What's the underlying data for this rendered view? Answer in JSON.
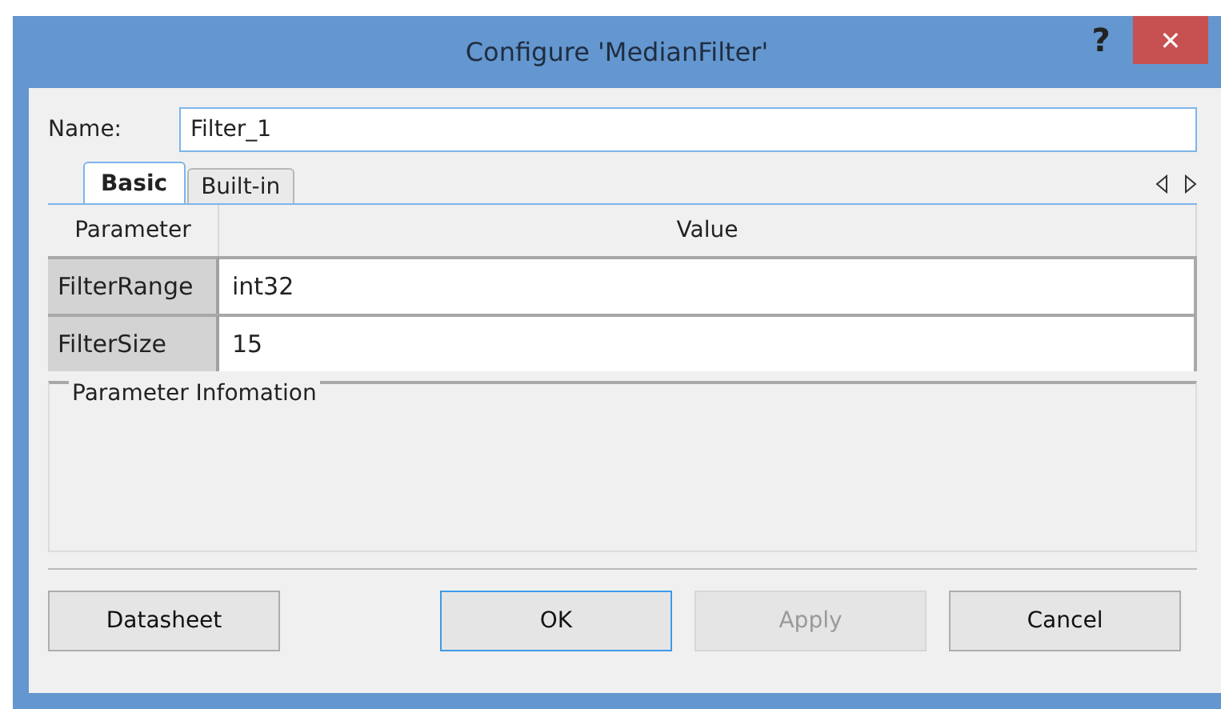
{
  "window": {
    "title": "Configure 'MedianFilter'",
    "help": "?",
    "close": "✕"
  },
  "name_field": {
    "label": "Name:",
    "value": "Filter_1"
  },
  "tabs": [
    {
      "label": "Basic",
      "selected": true
    },
    {
      "label": "Built-in",
      "selected": false
    }
  ],
  "table": {
    "columns": [
      "Parameter",
      "Value"
    ],
    "rows": [
      {
        "parameter": "FilterRange",
        "value": "int32"
      },
      {
        "parameter": "FilterSize",
        "value": "15"
      }
    ]
  },
  "info_group": {
    "title": "Parameter Infomation"
  },
  "buttons": [
    {
      "label": "Datasheet",
      "disabled": false,
      "default": false
    },
    {
      "label": "OK",
      "disabled": false,
      "default": true
    },
    {
      "label": "Apply",
      "disabled": true,
      "default": false
    },
    {
      "label": "Cancel",
      "disabled": false,
      "default": false
    }
  ]
}
